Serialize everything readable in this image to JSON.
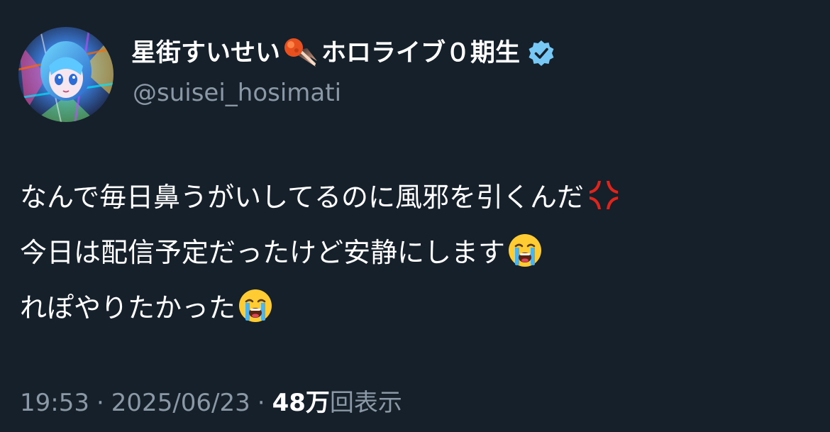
{
  "author": {
    "display_name_part1": "星街すいせい",
    "display_name_part2": "ホロライブ０期生",
    "handle": "@suisei_hosimati",
    "verified": true,
    "verified_color": "#78c8f5"
  },
  "tweet": {
    "lines": [
      "なんで毎日鼻うがいしてるのに風邪を引くんだ",
      "今日は配信予定だったけど安静にします",
      "れぽやりたかった"
    ],
    "emojis": [
      "anger-symbol-emoji",
      "loudly-crying-face-emoji",
      "loudly-crying-face-emoji"
    ]
  },
  "meta": {
    "time": "19:53",
    "separator": "·",
    "date": "2025/06/23",
    "views_count": "48万",
    "views_label": "回表示"
  },
  "colors": {
    "background": "#15202b",
    "text": "#ffffff",
    "secondary_text": "#8b98a5"
  }
}
